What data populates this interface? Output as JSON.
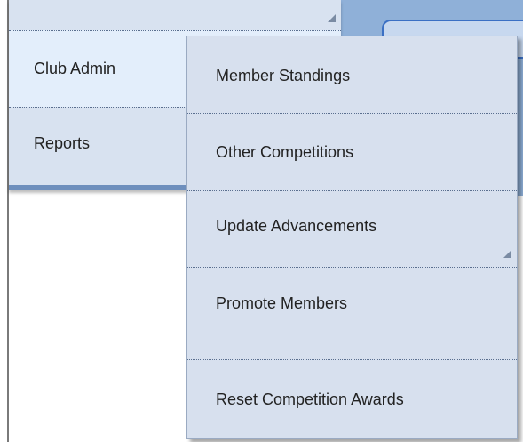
{
  "main_menu": {
    "items": [
      {
        "label": "Club Admin"
      },
      {
        "label": "Reports"
      }
    ]
  },
  "sub_menu": {
    "items": [
      {
        "label": "Member Standings"
      },
      {
        "label": "Other Competitions"
      },
      {
        "label": "Update Advancements"
      },
      {
        "label": "Promote Members"
      },
      {
        "label": "Reset Competition Awards"
      }
    ]
  },
  "colors": {
    "menu_bg": "#d8e2f0",
    "active_item_bg": "#e3eefb",
    "accent_blue": "#3b70c4"
  }
}
